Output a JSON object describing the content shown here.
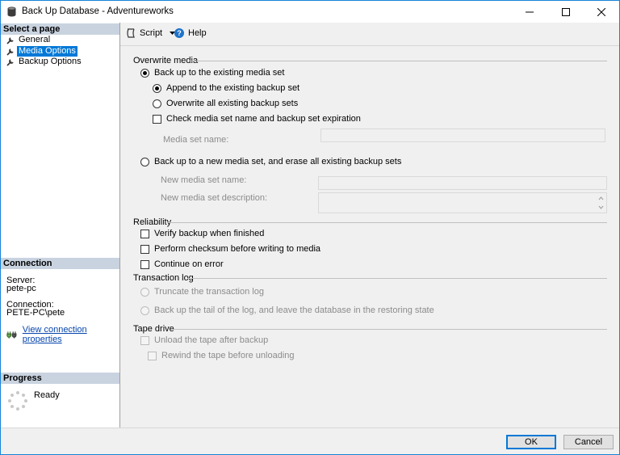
{
  "window": {
    "title": "Back Up Database - Adventureworks",
    "controls": {
      "minimize": "minimize-icon",
      "maximize": "maximize-icon",
      "close": "close-icon"
    }
  },
  "left_panel": {
    "select_page_header": "Select a page",
    "pages": [
      {
        "label": "General",
        "icon": "wrench-icon",
        "selected": false
      },
      {
        "label": "Media Options",
        "icon": "wrench-icon",
        "selected": true
      },
      {
        "label": "Backup Options",
        "icon": "wrench-icon",
        "selected": false
      }
    ],
    "connection_header": "Connection",
    "server_label": "Server:",
    "server_value": "pete-pc",
    "connection_label": "Connection:",
    "connection_value": "PETE-PC\\pete",
    "view_connection_link": "View connection properties",
    "progress_header": "Progress",
    "progress_status": "Ready"
  },
  "toolbar": {
    "script_label": "Script",
    "help_label": "Help"
  },
  "overwrite_media": {
    "title": "Overwrite media",
    "existing_set": {
      "label": "Back up to the existing media set",
      "checked": true
    },
    "append": {
      "label": "Append to the existing backup set",
      "checked": true
    },
    "overwrite_all": {
      "label": "Overwrite all existing backup sets",
      "checked": false
    },
    "check_media": {
      "label": "Check media set name and backup set expiration",
      "checked": false
    },
    "media_set_name_label": "Media set name:",
    "media_set_name_value": "",
    "new_media_set": {
      "label": "Back up to a new media set, and erase all existing backup sets",
      "checked": false
    },
    "new_media_set_name_label": "New media set name:",
    "new_media_set_name_value": "",
    "new_media_set_desc_label": "New media set description:",
    "new_media_set_desc_value": ""
  },
  "reliability": {
    "title": "Reliability",
    "verify": {
      "label": "Verify backup when finished",
      "checked": false
    },
    "checksum": {
      "label": "Perform checksum before writing to media",
      "checked": false
    },
    "continue_on_error": {
      "label": "Continue on error",
      "checked": false
    }
  },
  "transaction_log": {
    "title": "Transaction log",
    "truncate": {
      "label": "Truncate the transaction log",
      "enabled": false
    },
    "tail": {
      "label": "Back up the tail of the log, and leave the database in the restoring state",
      "enabled": false
    }
  },
  "tape_drive": {
    "title": "Tape drive",
    "unload": {
      "label": "Unload the tape after backup",
      "enabled": false
    },
    "rewind": {
      "label": "Rewind the tape before unloading",
      "enabled": false
    }
  },
  "buttons": {
    "ok": "OK",
    "cancel": "Cancel"
  },
  "colors": {
    "accent": "#0078d7",
    "section_header": "#c9d3e0",
    "link": "#0645ad"
  }
}
